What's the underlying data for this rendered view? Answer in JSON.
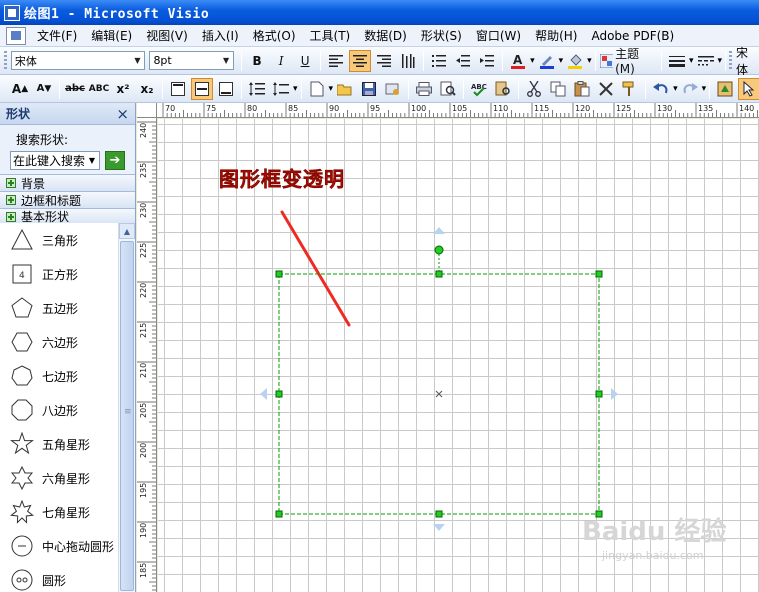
{
  "window": {
    "title": "绘图1 - Microsoft Visio"
  },
  "menubar": {
    "items": [
      "文件(F)",
      "编辑(E)",
      "视图(V)",
      "插入(I)",
      "格式(O)",
      "工具(T)",
      "数据(D)",
      "形状(S)",
      "窗口(W)",
      "帮助(H)",
      "Adobe PDF(B)"
    ]
  },
  "toolbar1": {
    "font_value": "宋体",
    "size_value": "8pt",
    "bold": "B",
    "italic": "I",
    "underline": "U",
    "theme_label": "主题(M)",
    "extra": "宋体"
  },
  "toolbar2": {
    "increase_font": "A",
    "decrease_font": "A",
    "strike": "abc",
    "small_caps": "ABC",
    "superscript": "x²",
    "subscript": "x₂"
  },
  "shapes_panel": {
    "title": "形状",
    "close": "×",
    "search_label": "搜索形状:",
    "search_placeholder": "在此键入搜索",
    "go": "➔",
    "stencils": [
      "背景",
      "边框和标题",
      "基本形状"
    ],
    "shapes": [
      "三角形",
      "正方形",
      "五边形",
      "六边形",
      "七边形",
      "八边形",
      "五角星形",
      "六角星形",
      "七角星形",
      "中心拖动圆形",
      "圆形"
    ],
    "square_number": "4"
  },
  "ruler": {
    "h_labels": [
      "70",
      "75",
      "80",
      "85",
      "90",
      "95",
      "100",
      "105",
      "110",
      "115",
      "120",
      "125",
      "130",
      "135",
      "140"
    ],
    "v_labels": [
      "240",
      "235",
      "230",
      "225",
      "220",
      "215",
      "210",
      "205",
      "200",
      "195",
      "190",
      "185"
    ]
  },
  "canvas": {
    "annotation": "图形框变透明",
    "watermark": "Baidu 经验",
    "watermark_url": "jingyan.baidu.com"
  },
  "colors": {
    "title_bar": "#0a5ddf",
    "annotation": "#e8201a",
    "selection": "#00a000",
    "handle": "#00c000",
    "connection_arrow": "#9fc4ec"
  }
}
